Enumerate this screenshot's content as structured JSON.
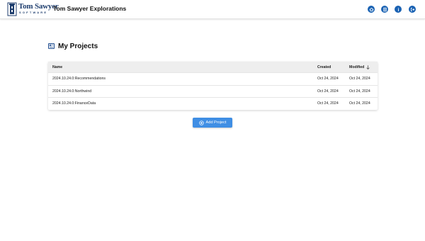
{
  "header": {
    "logo_line1": "Tom Sawyer",
    "logo_line2": "SOFTWARE",
    "app_title": "Tom Sawyer Explorations",
    "icons": [
      "home-icon",
      "document-icon",
      "info-icon",
      "logout-icon"
    ]
  },
  "main": {
    "page_title": "My Projects",
    "table": {
      "columns": {
        "name": "Name",
        "created": "Created",
        "modified": "Modified"
      },
      "sort": {
        "column": "modified",
        "direction": "descending"
      },
      "rows": [
        {
          "name": "2024.10.24.0:Recommendations",
          "created": "Oct 24, 2024",
          "modified": "Oct 24, 2024"
        },
        {
          "name": "2024.10.24.0:Northwind",
          "created": "Oct 24, 2024",
          "modified": "Oct 24, 2024"
        },
        {
          "name": "2024.10.24.0:FinanceData",
          "created": "Oct 24, 2024",
          "modified": "Oct 24, 2024"
        }
      ]
    },
    "add_button_label": "Add Project"
  },
  "colors": {
    "accent": "#3f8ee4",
    "header_icon": "#1a62b3",
    "logo": "#1f3e6e"
  }
}
